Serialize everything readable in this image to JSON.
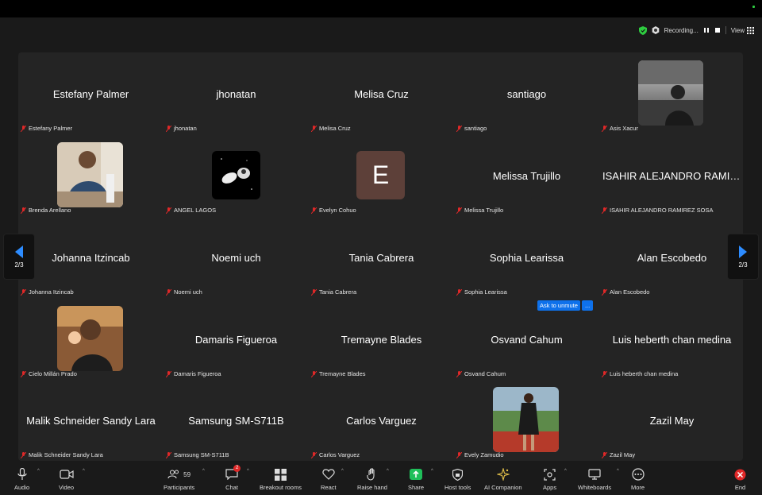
{
  "topbar": {
    "recording_label": "Recording...",
    "view_label": "View"
  },
  "navigation": {
    "page_indicator_left": "2/3",
    "page_indicator_right": "2/3"
  },
  "ask_to_unmute": {
    "label": "Ask to unmute",
    "more": "..."
  },
  "participants": [
    {
      "display": "Estefany Palmer",
      "label": "Estefany Palmer"
    },
    {
      "display": "jhonatan",
      "label": "jhonatan"
    },
    {
      "display": "Melisa Cruz",
      "label": "Melisa Cruz"
    },
    {
      "display": "santiago",
      "label": "santiago"
    },
    {
      "display": "",
      "label": "Asis Xacur"
    },
    {
      "display": "",
      "label": "Brenda Arellano"
    },
    {
      "display": "",
      "label": "ANGEL LAGOS"
    },
    {
      "display": "E",
      "label": "Evelyn Cohuo"
    },
    {
      "display": "Melissa Trujillo",
      "label": "Melissa Trujillo"
    },
    {
      "display": "ISAHIR ALEJANDRO RAMIR...",
      "label": "ISAHIR ALEJANDRO RAMIREZ SOSA"
    },
    {
      "display": "Johanna Itzincab",
      "label": "Johanna Itzincab"
    },
    {
      "display": "Noemi uch",
      "label": "Noemi uch"
    },
    {
      "display": "Tania Cabrera",
      "label": "Tania Cabrera"
    },
    {
      "display": "Sophia Learissa",
      "label": "Sophia Learissa"
    },
    {
      "display": "Alan Escobedo",
      "label": "Alan Escobedo"
    },
    {
      "display": "",
      "label": "Cielo Millán Prado"
    },
    {
      "display": "Damaris Figueroa",
      "label": "Damaris Figueroa"
    },
    {
      "display": "Tremayne Blades",
      "label": "Tremayne Blades"
    },
    {
      "display": "Osvand Cahum",
      "label": "Osvand Cahum"
    },
    {
      "display": "Luis heberth chan medina",
      "label": "Luis heberth chan medina"
    },
    {
      "display": "Malik Schneider Sandy Lara",
      "label": "Malik Schneider Sandy Lara"
    },
    {
      "display": "Samsung SM-S711B",
      "label": "Samsung SM-S711B"
    },
    {
      "display": "Carlos Varguez",
      "label": "Carlos Varguez"
    },
    {
      "display": "",
      "label": "Evely Zamudio"
    },
    {
      "display": "Zazil May",
      "label": "Zazil May"
    }
  ],
  "toolbar": {
    "audio": "Audio",
    "video": "Video",
    "participants": "Participants",
    "participants_count": "59",
    "chat": "Chat",
    "chat_badge": "2",
    "breakout": "Breakout rooms",
    "react": "React",
    "raise_hand": "Raise hand",
    "share": "Share",
    "host_tools": "Host tools",
    "ai_companion": "AI Companion",
    "apps": "Apps",
    "whiteboards": "Whiteboards",
    "more": "More",
    "end": "End"
  },
  "colors": {
    "accent": "#0e71eb",
    "share_green": "#1fbf5a",
    "end_red": "#e02828",
    "muted_mic": "#e02828"
  }
}
